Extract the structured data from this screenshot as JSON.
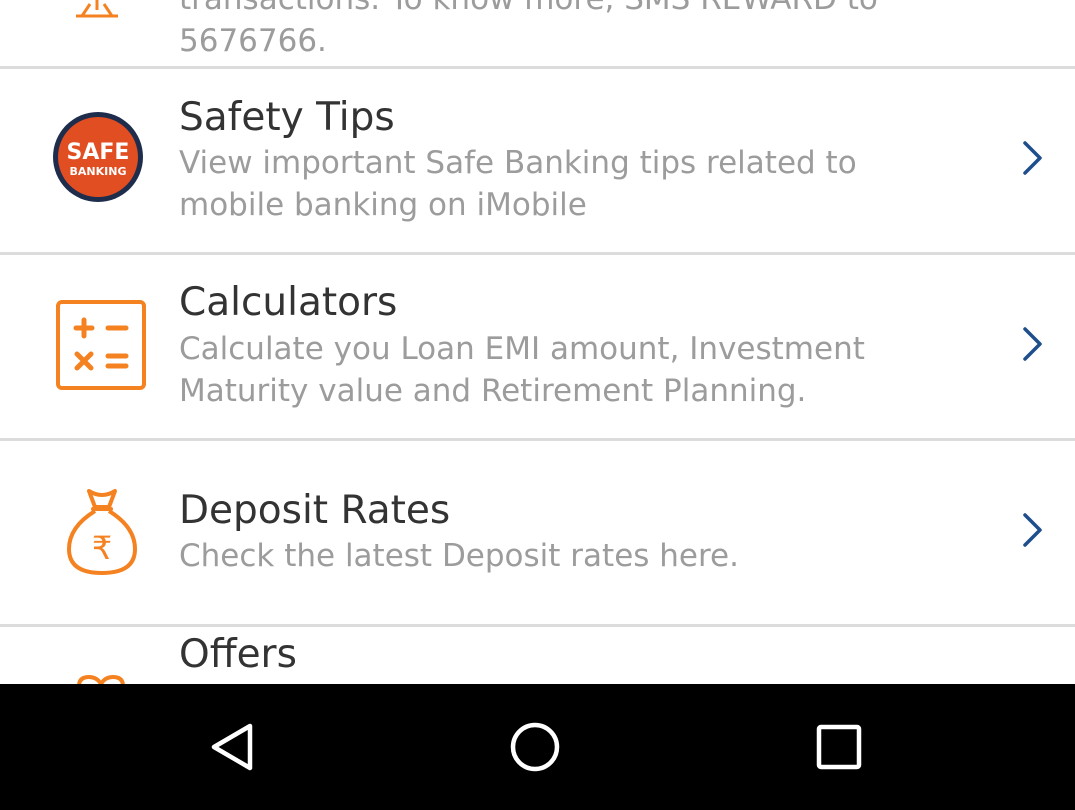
{
  "top_item": {
    "desc_partial_line1": "transactions. To know more, SMS REWARD to",
    "desc_partial_line2": "5676766."
  },
  "items": [
    {
      "title": "Safety Tips",
      "desc": "View important Safe Banking tips related to mobile banking on iMobile",
      "icon": "safe-banking-icon",
      "icon_text_line1": "SAFE",
      "icon_text_line2": "BANKING"
    },
    {
      "title": "Calculators",
      "desc": "Calculate you Loan EMI amount, Investment Maturity value and Retirement Planning.",
      "icon": "calculator-icon"
    },
    {
      "title": "Deposit Rates",
      "desc": "Check the latest Deposit rates here.",
      "icon": "money-bag-icon"
    },
    {
      "title": "Offers",
      "icon": "gift-icon"
    }
  ],
  "colors": {
    "accent_orange": "#f58220",
    "safe_red": "#e04e22",
    "safe_navy": "#1f2d4d",
    "chevron_blue": "#1f4e8c",
    "title_text": "#333333",
    "desc_text": "#9c9c9c",
    "separator": "#dcdcdc",
    "navbar": "#000000"
  },
  "navbar": {
    "buttons": [
      "back-icon",
      "home-icon",
      "recents-icon"
    ]
  }
}
